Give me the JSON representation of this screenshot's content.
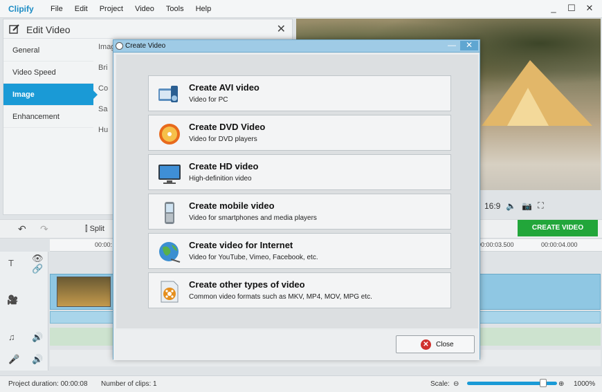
{
  "app": {
    "logo": "Clipify",
    "menu": [
      "File",
      "Edit",
      "Project",
      "Video",
      "Tools",
      "Help"
    ],
    "window_controls": [
      "_",
      "☐",
      "✕"
    ]
  },
  "edit_panel": {
    "title": "Edit Video",
    "close": "✕",
    "nav": [
      "General",
      "Video Speed",
      "Image",
      "Enhancement"
    ],
    "active_nav": "Image",
    "content_labels": [
      "Imag",
      "Bri",
      "Co",
      "Sa",
      "Hu"
    ]
  },
  "preview": {
    "aspect": "16:9"
  },
  "toolbar": {
    "split_label": "Split",
    "create_video_label": "CREATE VIDEO"
  },
  "timeline": {
    "ruler_labels": [
      "00:00:",
      "00:00:03.500",
      "00:00:04.000"
    ]
  },
  "status": {
    "duration": "Project duration:  00:00:08",
    "clips": "Number of clips: 1",
    "scale_label": "Scale:",
    "scale_value": "1000%"
  },
  "dialog": {
    "title": "Create Video",
    "minimize": "—",
    "close_x": "✕",
    "options": [
      {
        "title": "Create AVI video",
        "desc": "Video for PC",
        "icon": "avi-film-icon"
      },
      {
        "title": "Create DVD Video",
        "desc": "Video for DVD players",
        "icon": "dvd-disc-icon"
      },
      {
        "title": "Create HD video",
        "desc": "High-definition video",
        "icon": "hd-monitor-icon"
      },
      {
        "title": "Create mobile video",
        "desc": "Video for smartphones and media players",
        "icon": "mobile-phone-icon"
      },
      {
        "title": "Create video for Internet",
        "desc": "Video for YouTube, Vimeo, Facebook, etc.",
        "icon": "globe-icon"
      },
      {
        "title": "Create other types of video",
        "desc": "Common video formats such as MKV, MP4, MOV, MPG etc.",
        "icon": "file-reel-icon"
      }
    ],
    "close_button_label": "Close"
  }
}
